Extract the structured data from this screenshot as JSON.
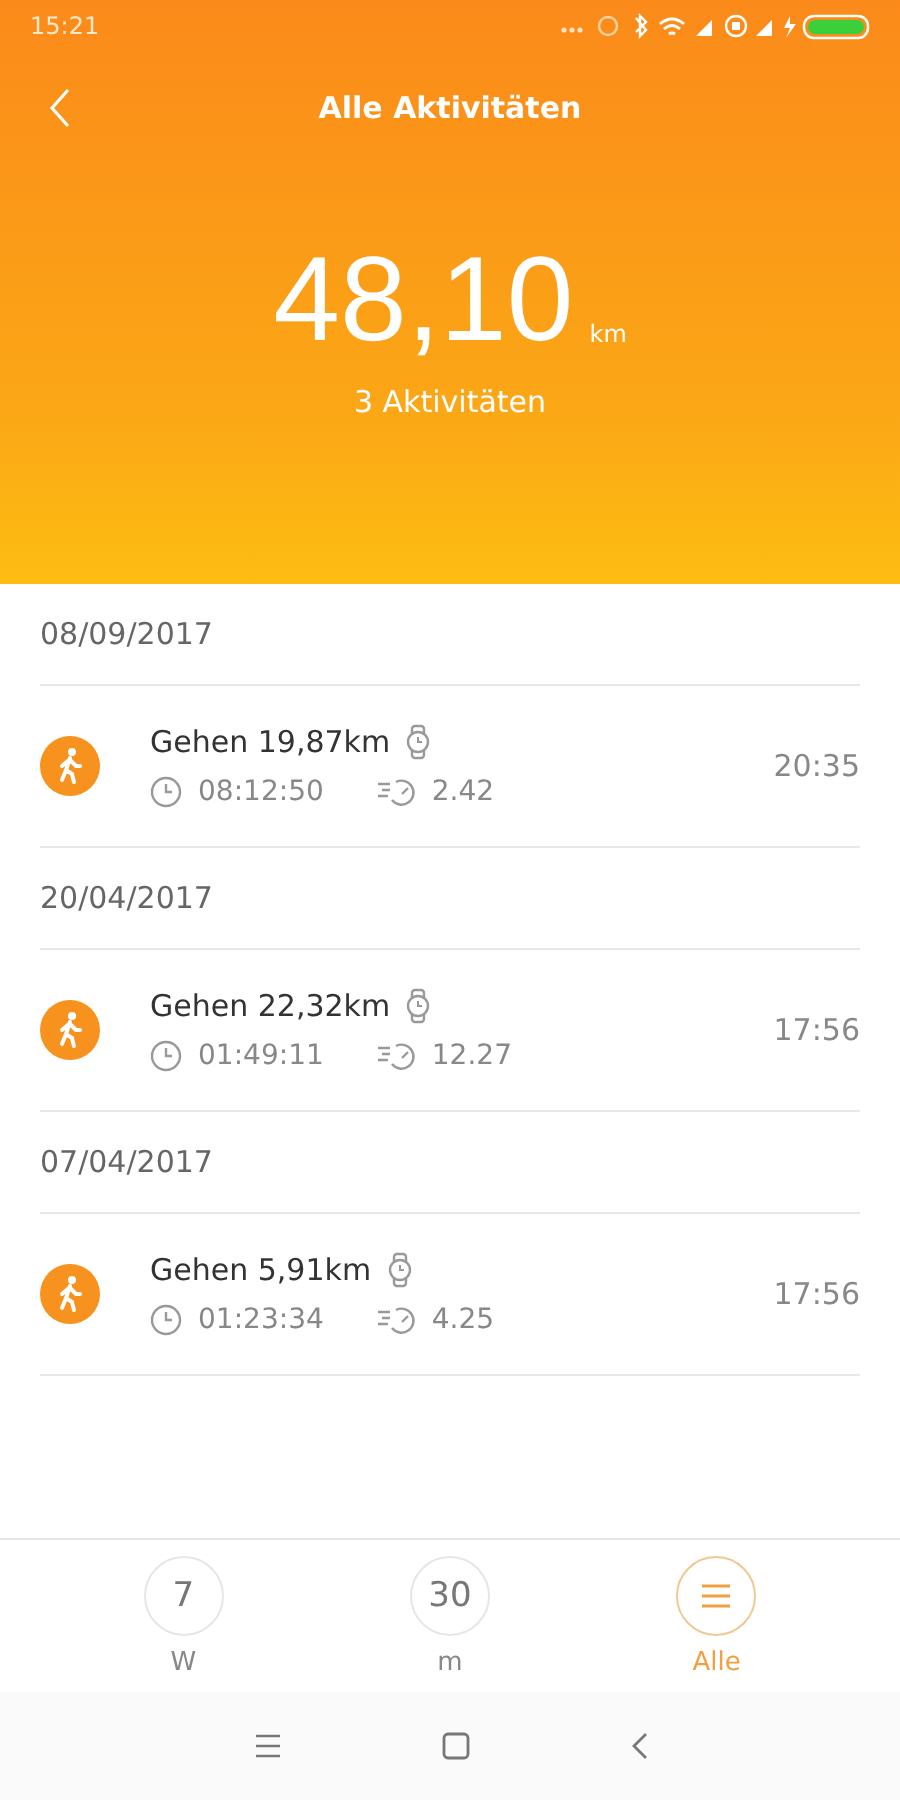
{
  "status_bar": {
    "time": "15:21"
  },
  "header": {
    "title": "Alle Aktivitäten",
    "total": "48,10",
    "unit": "km",
    "count": "3 Aktivitäten"
  },
  "groups": [
    {
      "date": "08/09/2017",
      "activities": [
        {
          "title": "Gehen 19,87km",
          "duration": "08:12:50",
          "pace": "2.42",
          "time": "20:35"
        }
      ]
    },
    {
      "date": "20/04/2017",
      "activities": [
        {
          "title": "Gehen 22,32km",
          "duration": "01:49:11",
          "pace": "12.27",
          "time": "17:56"
        }
      ]
    },
    {
      "date": "07/04/2017",
      "activities": [
        {
          "title": "Gehen 5,91km",
          "duration": "01:23:34",
          "pace": "4.25",
          "time": "17:56"
        }
      ]
    }
  ],
  "period_tabs": [
    {
      "kind": "number",
      "value": "7",
      "label": "W",
      "selected": false
    },
    {
      "kind": "number",
      "value": "30",
      "label": "m",
      "selected": false
    },
    {
      "kind": "icon",
      "label": "Alle",
      "selected": true
    }
  ]
}
